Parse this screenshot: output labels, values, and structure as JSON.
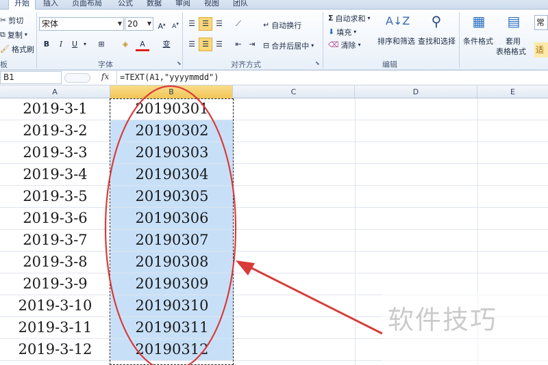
{
  "tabs": [
    "开始",
    "插入",
    "页面布局",
    "公式",
    "数据",
    "审阅",
    "视图",
    "团队"
  ],
  "clipboard": {
    "cut": "剪切",
    "copy": "复制",
    "painter": "格式刷",
    "label": "剪贴板"
  },
  "font": {
    "name": "宋体",
    "size": "20",
    "label": "字体",
    "bold": "B",
    "italic": "I",
    "underline": "U",
    "font_color_glyph": "A",
    "phonetic_glyph": "变"
  },
  "align": {
    "wrap": "自动换行",
    "merge": "合并后居中",
    "label": "对齐方式"
  },
  "editing": {
    "autosum": "自动求和",
    "fill": "填充",
    "clear": "清除",
    "sort": "排序和筛选",
    "find": "查找和选择",
    "label": "编辑"
  },
  "styles": {
    "cond": "条件格式",
    "table_fmt_1": "套用",
    "table_fmt_2": "表格格式",
    "normal": "常",
    "fit": "适"
  },
  "formula_bar": {
    "name_box": "B1",
    "fx": "fx",
    "formula": "=TEXT(A1,\"yyyymmdd\")"
  },
  "columns": [
    "A",
    "B",
    "C",
    "D",
    "E"
  ],
  "rows": [
    [
      "2019-3-1",
      "20190301"
    ],
    [
      "2019-3-2",
      "20190302"
    ],
    [
      "2019-3-3",
      "20190303"
    ],
    [
      "2019-3-4",
      "20190304"
    ],
    [
      "2019-3-5",
      "20190305"
    ],
    [
      "2019-3-6",
      "20190306"
    ],
    [
      "2019-3-7",
      "20190307"
    ],
    [
      "2019-3-8",
      "20190308"
    ],
    [
      "2019-3-9",
      "20190309"
    ],
    [
      "2019-3-10",
      "20190310"
    ],
    [
      "2019-3-11",
      "20190311"
    ],
    [
      "2019-3-12",
      "20190312"
    ]
  ],
  "watermark": "软件技巧",
  "colors": {
    "selection_fill": "#c7e0f8",
    "annotation": "#d93a3a",
    "active_header": "#f2c556"
  }
}
